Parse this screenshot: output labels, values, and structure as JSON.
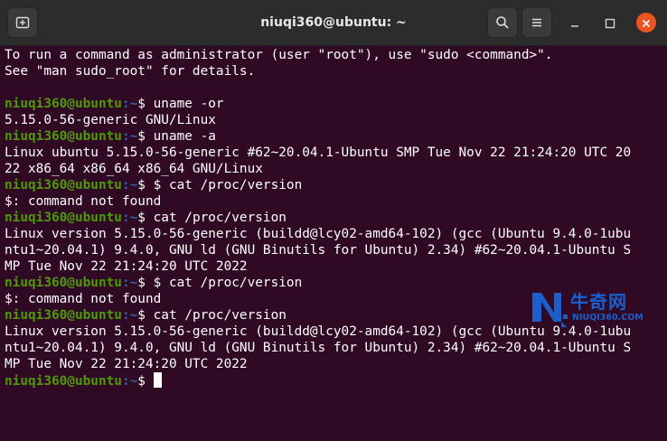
{
  "window": {
    "title": "niuqi360@ubuntu: ~"
  },
  "colors": {
    "background": "#300a24",
    "titlebar": "#2c2c2c",
    "prompt_user": "#4e9a06",
    "prompt_path": "#3465a4",
    "text": "#ffffff",
    "close_button": "#e95420"
  },
  "icons": {
    "new_tab": "new-tab-icon",
    "search": "search-icon",
    "menu": "hamburger-menu-icon",
    "minimize": "minimize-icon",
    "maximize": "maximize-icon",
    "close": "close-icon"
  },
  "prompt": {
    "user_host": "niuqi360@ubuntu",
    "path": ":~",
    "symbol": "$ "
  },
  "terminal": {
    "lines": [
      {
        "type": "out",
        "text": "To run a command as administrator (user \"root\"), use \"sudo <command>\"."
      },
      {
        "type": "out",
        "text": "See \"man sudo_root\" for details."
      },
      {
        "type": "out",
        "text": ""
      },
      {
        "type": "cmd",
        "command": "uname -or"
      },
      {
        "type": "out",
        "text": "5.15.0-56-generic GNU/Linux"
      },
      {
        "type": "cmd",
        "command": "uname -a"
      },
      {
        "type": "out",
        "text": "Linux ubuntu 5.15.0-56-generic #62~20.04.1-Ubuntu SMP Tue Nov 22 21:24:20 UTC 20"
      },
      {
        "type": "out",
        "text": "22 x86_64 x86_64 x86_64 GNU/Linux"
      },
      {
        "type": "cmd",
        "command": "$ cat /proc/version"
      },
      {
        "type": "out",
        "text": "$: command not found"
      },
      {
        "type": "cmd",
        "command": "cat /proc/version"
      },
      {
        "type": "out",
        "text": "Linux version 5.15.0-56-generic (buildd@lcy02-amd64-102) (gcc (Ubuntu 9.4.0-1ubu"
      },
      {
        "type": "out",
        "text": "ntu1~20.04.1) 9.4.0, GNU ld (GNU Binutils for Ubuntu) 2.34) #62~20.04.1-Ubuntu S"
      },
      {
        "type": "out",
        "text": "MP Tue Nov 22 21:24:20 UTC 2022"
      },
      {
        "type": "cmd",
        "command": "$ cat /proc/version"
      },
      {
        "type": "out",
        "text": "$: command not found"
      },
      {
        "type": "cmd",
        "command": "cat /proc/version"
      },
      {
        "type": "out",
        "text": "Linux version 5.15.0-56-generic (buildd@lcy02-amd64-102) (gcc (Ubuntu 9.4.0-1ubu"
      },
      {
        "type": "out",
        "text": "ntu1~20.04.1) 9.4.0, GNU ld (GNU Binutils for Ubuntu) 2.34) #62~20.04.1-Ubuntu S"
      },
      {
        "type": "out",
        "text": "MP Tue Nov 22 21:24:20 UTC 2022"
      },
      {
        "type": "cmd",
        "command": "",
        "cursor": true
      }
    ]
  },
  "watermark": {
    "brand_cn": "牛奇网",
    "url": "NIUQI360.COM"
  }
}
